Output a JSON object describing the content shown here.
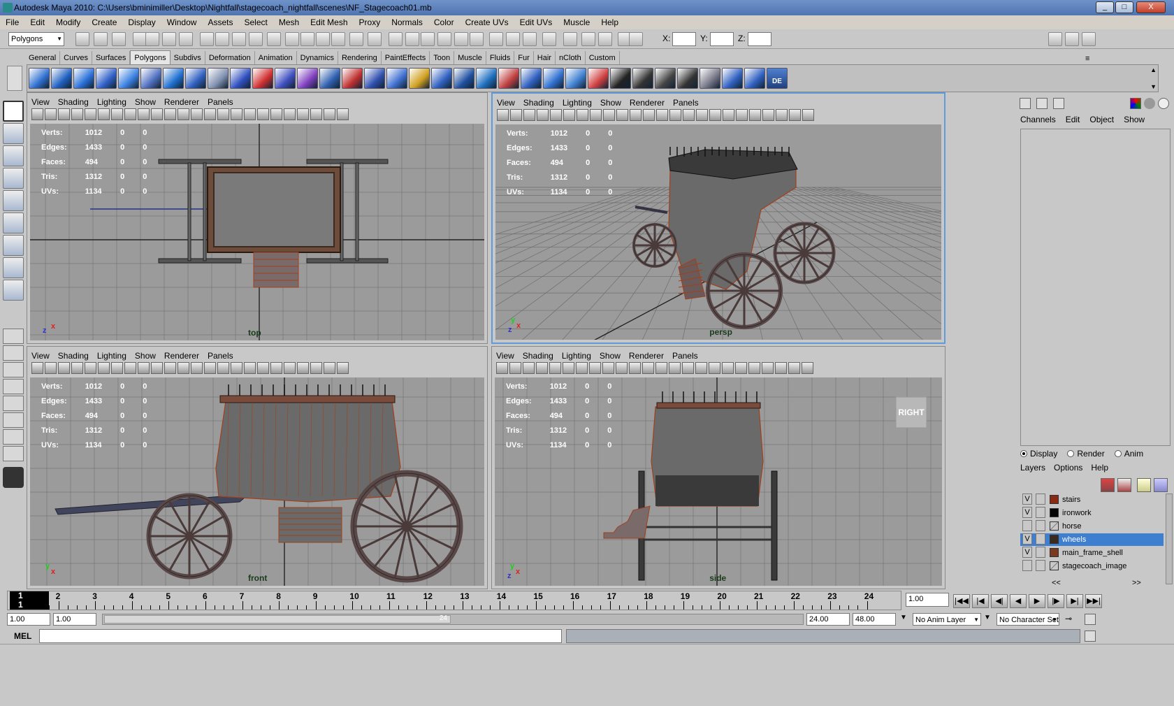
{
  "window": {
    "title": "Autodesk Maya 2010: C:\\Users\\bminimiller\\Desktop\\Nightfall\\stagecoach_nightfall\\scenes\\NF_Stagecoach01.mb",
    "minimize": "_",
    "maximize": "□",
    "close": "X"
  },
  "menubar": [
    "File",
    "Edit",
    "Modify",
    "Create",
    "Display",
    "Window",
    "Assets",
    "Select",
    "Mesh",
    "Edit Mesh",
    "Proxy",
    "Normals",
    "Color",
    "Create UVs",
    "Edit UVs",
    "Muscle",
    "Help"
  ],
  "statusline": {
    "menuset": "Polygons",
    "x_label": "X:",
    "y_label": "Y:",
    "z_label": "Z:",
    "x_value": "",
    "y_value": "",
    "z_value": ""
  },
  "shelf_tabs": [
    "General",
    "Curves",
    "Surfaces",
    "Polygons",
    "Subdivs",
    "Deformation",
    "Animation",
    "Dynamics",
    "Rendering",
    "PaintEffects",
    "Toon",
    "Muscle",
    "Fluids",
    "Fur",
    "Hair",
    "nCloth",
    "Custom"
  ],
  "shelf_active": "Polygons",
  "shelf_last_label": "DE",
  "viewport_menu": [
    "View",
    "Shading",
    "Lighting",
    "Show",
    "Renderer",
    "Panels"
  ],
  "hud": {
    "rows": [
      {
        "label": "Verts:",
        "v1": "1012",
        "v2": "0",
        "v3": "0"
      },
      {
        "label": "Edges:",
        "v1": "1433",
        "v2": "0",
        "v3": "0"
      },
      {
        "label": "Faces:",
        "v1": "494",
        "v2": "0",
        "v3": "0"
      },
      {
        "label": "Tris:",
        "v1": "1312",
        "v2": "0",
        "v3": "0"
      },
      {
        "label": "UVs:",
        "v1": "1134",
        "v2": "0",
        "v3": "0"
      }
    ]
  },
  "viewports": {
    "top": "top",
    "persp": "persp",
    "front": "front",
    "side": "side"
  },
  "viewcube_label": "RIGHT",
  "channelbox": {
    "menu": [
      "Channels",
      "Edit",
      "Object",
      "Show"
    ]
  },
  "layer_editor": {
    "modes": [
      "Display",
      "Render",
      "Anim"
    ],
    "menu": [
      "Layers",
      "Options",
      "Help"
    ],
    "layers": [
      {
        "v": "V",
        "name": "stairs",
        "color": "#8b2a12",
        "selected": false
      },
      {
        "v": "V",
        "name": "ironwork",
        "color": "#050505",
        "selected": false
      },
      {
        "v": "",
        "name": "horse",
        "color": "",
        "selected": false
      },
      {
        "v": "V",
        "name": "wheels",
        "color": "#3b2a20",
        "selected": true
      },
      {
        "v": "V",
        "name": "main_frame_shell",
        "color": "#7a3a22",
        "selected": false
      },
      {
        "v": "",
        "name": "stagecoach_image",
        "color": "",
        "selected": false
      }
    ],
    "scroll_left": "<<",
    "scroll_right": ">>"
  },
  "timeline": {
    "current_frame": "1",
    "ticks": [
      "1",
      "2",
      "3",
      "4",
      "5",
      "6",
      "7",
      "8",
      "9",
      "10",
      "11",
      "12",
      "13",
      "14",
      "15",
      "16",
      "17",
      "18",
      "19",
      "20",
      "21",
      "22",
      "23",
      "24"
    ],
    "current_time": "1.00",
    "marker": "24"
  },
  "range": {
    "start": "1.00",
    "playback_start": "1.00",
    "playback_end": "24.00",
    "end": "48.00",
    "anim_layer": "No Anim Layer",
    "char_set": "No Character Set"
  },
  "command": {
    "label": "MEL",
    "value": ""
  }
}
